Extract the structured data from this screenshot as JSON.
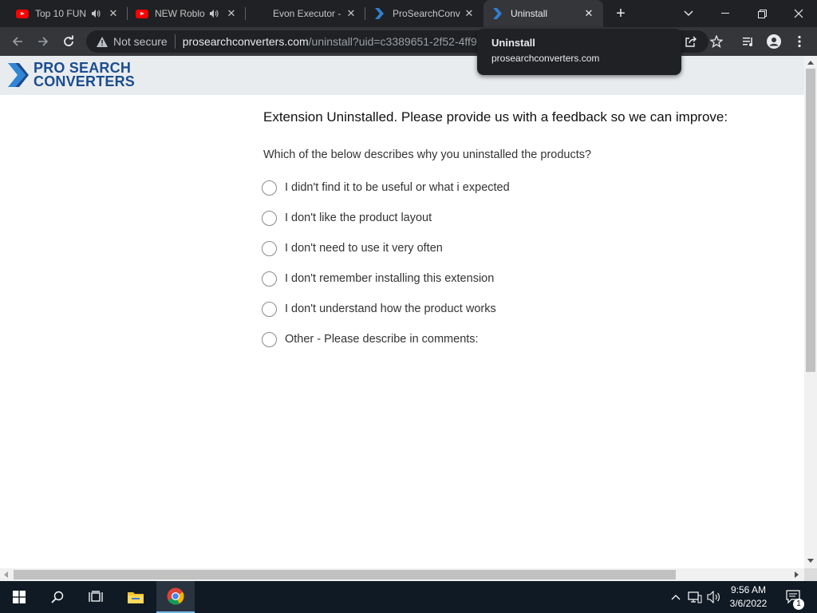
{
  "browser": {
    "tabs": [
      {
        "title": "Top 10 FUN",
        "favicon": "youtube-icon",
        "audio": true
      },
      {
        "title": "NEW Roblo",
        "favicon": "youtube-icon",
        "audio": true
      },
      {
        "title": "Evon Executor -",
        "favicon": "",
        "audio": false
      },
      {
        "title": "ProSearchConv",
        "favicon": "prosearch-icon",
        "audio": false
      },
      {
        "title": "Uninstall",
        "favicon": "prosearch-icon",
        "audio": false,
        "active": true
      }
    ],
    "omnibox": {
      "security_label": "Not secure",
      "url_host": "prosearchconverters.com",
      "url_path": "/uninstall?uid=c3389651-2f52-4ff9"
    },
    "tooltip": {
      "title": "Uninstall",
      "subtitle": "prosearchconverters.com"
    },
    "colors": {
      "frame": "#202124",
      "toolbar": "#35363a",
      "accent": "#1a4d8f"
    }
  },
  "site": {
    "logo_line1": "PRO SEARCH",
    "logo_line2": "CONVERTERS"
  },
  "page": {
    "heading": "Extension Uninstalled. Please provide us with a feedback so we can improve:",
    "question": "Which of the below describes why you uninstalled the products?",
    "options": [
      "I didn't find it to be useful or what i expected",
      "I don't like the product layout",
      "I don't need to use it very often",
      "I don't remember installing this extension",
      "I don't understand how the product works",
      "Other - Please describe in comments:"
    ]
  },
  "taskbar": {
    "time": "9:56 AM",
    "date": "3/6/2022",
    "notification_count": "1",
    "pinned": [
      "windows-start-icon",
      "search-icon",
      "task-view-icon",
      "file-explorer-icon",
      "chrome-icon"
    ]
  }
}
